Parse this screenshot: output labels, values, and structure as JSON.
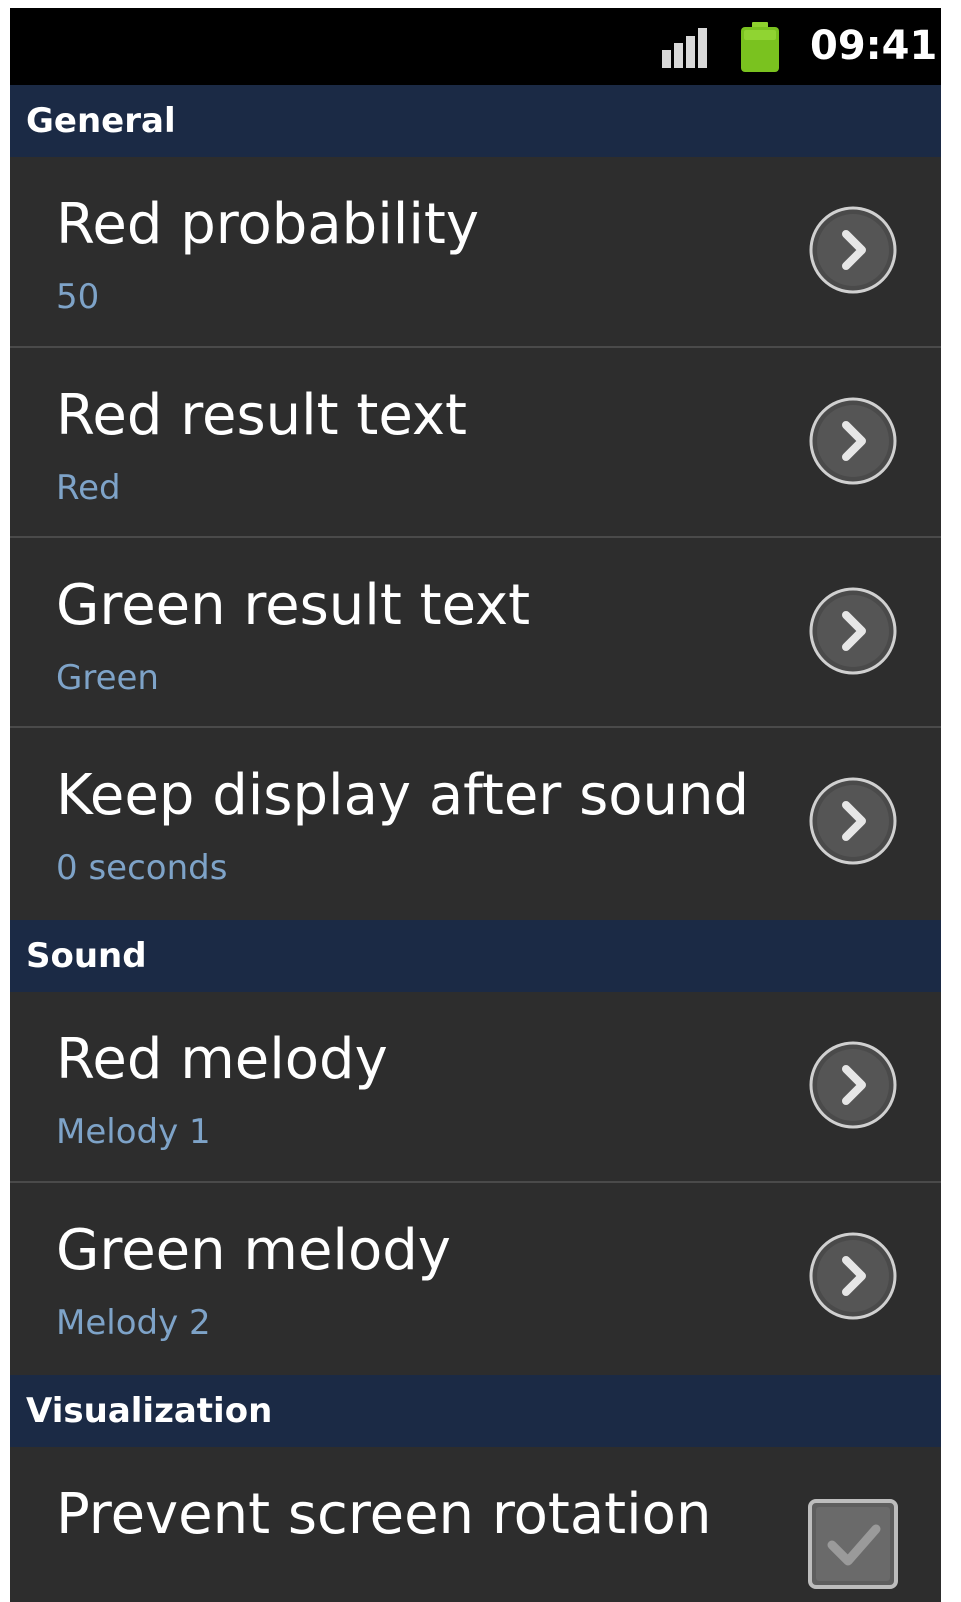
{
  "status_bar": {
    "time": "09:41",
    "signal_icon": "signal-bars-icon",
    "battery_icon": "battery-icon",
    "battery_color": "#7ac21f"
  },
  "colors": {
    "background": "#2d2d2d",
    "section_header_bg": "#1b2a45",
    "summary_text": "#7ea3c8",
    "divider": "#4a4a4a"
  },
  "sections": [
    {
      "header": "General",
      "items": [
        {
          "title": "Red probability",
          "summary": "50",
          "icon": "chevron-right-circle-icon"
        },
        {
          "title": "Red result text",
          "summary": "Red",
          "icon": "chevron-right-circle-icon"
        },
        {
          "title": "Green result text",
          "summary": "Green",
          "icon": "chevron-right-circle-icon"
        },
        {
          "title": "Keep display after sound",
          "summary": "0 seconds",
          "icon": "chevron-right-circle-icon"
        }
      ]
    },
    {
      "header": "Sound",
      "items": [
        {
          "title": "Red melody",
          "summary": "Melody 1",
          "icon": "chevron-right-circle-icon"
        },
        {
          "title": "Green melody",
          "summary": "Melody 2",
          "icon": "chevron-right-circle-icon"
        }
      ]
    },
    {
      "header": "Visualization",
      "items": [
        {
          "title": "Prevent screen rotation",
          "checked": true,
          "icon": "checkbox-checked-icon"
        }
      ]
    }
  ]
}
